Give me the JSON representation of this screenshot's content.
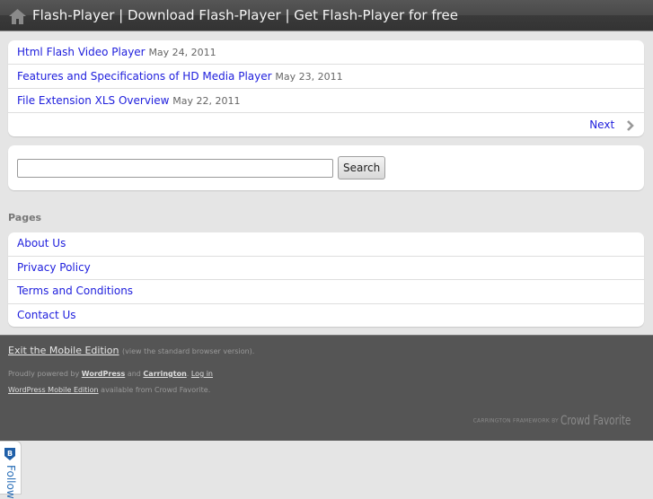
{
  "header": {
    "icon": "home-icon",
    "title": "Flash-Player | Download Flash-Player | Get Flash-Player for free"
  },
  "posts": {
    "items": [
      {
        "title": "Html Flash Video Player",
        "date": "May 24, 2011"
      },
      {
        "title": "Features and Specifications of HD Media Player",
        "date": "May 23, 2011"
      },
      {
        "title": "File Extension XLS Overview",
        "date": "May 22, 2011"
      }
    ],
    "next_label": "Next",
    "next_icon": "chevron-right-icon"
  },
  "search": {
    "value": "",
    "placeholder": "",
    "button_label": "Search"
  },
  "pages": {
    "title": "Pages",
    "items": [
      {
        "label": "About Us"
      },
      {
        "label": "Privacy Policy"
      },
      {
        "label": "Terms and Conditions"
      },
      {
        "label": "Contact Us"
      }
    ]
  },
  "footer": {
    "exit_label": "Exit the Mobile Edition",
    "exit_note": "(view the standard browser version).",
    "powered_prefix": "Proudly powered by",
    "wordpress_label": "WordPress",
    "and_text": "and",
    "carrington_label": "Carrington",
    "login_label": "Log in",
    "wpme_label": "WordPress Mobile Edition",
    "wpme_suffix": "available from Crowd Favorite.",
    "framework_text": "CARRINGTON FRAMEWORK BY",
    "crowd_favorite": "Crowd Favorite"
  },
  "follow_widget": {
    "label": "Follow",
    "icon": "bloglovin-badge-icon"
  }
}
